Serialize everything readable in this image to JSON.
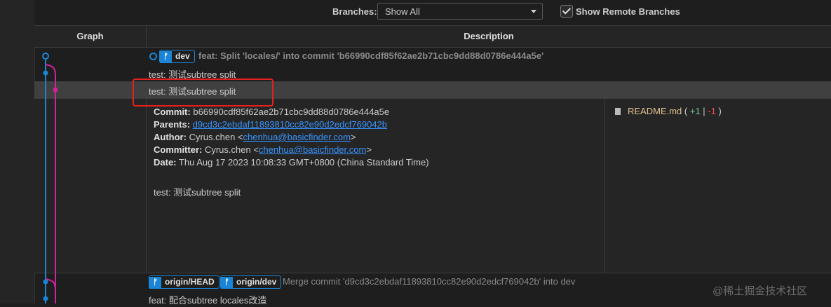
{
  "toolbar": {
    "branches_label": "Branches:",
    "branch_select_value": "Show All",
    "show_remote_label": "Show Remote Branches",
    "show_remote_checked": true
  },
  "table_header": {
    "graph": "Graph",
    "description": "Description"
  },
  "commits": [
    {
      "refs": [
        "dev"
      ],
      "message": "feat: Split 'locales/' into commit 'b66990cdf85f62ae2b71cbc9dd88d0786e444a5e'"
    },
    {
      "refs": [],
      "message": "test: 测试subtree split"
    },
    {
      "refs": [],
      "message": "test: 测试subtree split",
      "selected": true
    },
    {
      "refs": [
        "origin/HEAD",
        "origin/dev"
      ],
      "message": "Merge commit 'd9cd3c2ebdaf11893810cc82e90d2edcf769042b' into dev"
    },
    {
      "refs": [],
      "message": "feat: 配合subtree locales改造"
    }
  ],
  "details": {
    "commit_label": "Commit:",
    "commit_value": "b66990cdf85f62ae2b71cbc9dd88d0786e444a5e",
    "parents_label": "Parents:",
    "parents_value": "d9cd3c2ebdaf11893810cc82e90d2edcf769042b",
    "author_label": "Author:",
    "author_name": "Cyrus.chen <",
    "author_email": "chenhua@basicfinder.com",
    "author_suffix": ">",
    "committer_label": "Committer:",
    "committer_name": "Cyrus.chen <",
    "committer_email": "chenhua@basicfinder.com",
    "committer_suffix": ">",
    "date_label": "Date:",
    "date_value": "Thu Aug 17 2023 10:08:33 GMT+0800 (China Standard Time)",
    "body": "test: 测试subtree split"
  },
  "files": [
    {
      "name": "README.md",
      "open": " ( ",
      "plus": "+1",
      "bar": " | ",
      "minus": "-1",
      "close": " )"
    }
  ],
  "colors": {
    "blue_branch": "#1a85d6",
    "magenta_branch": "#d0229a",
    "highlight_box": "#e5201e"
  },
  "watermark": "@稀土掘金技术社区"
}
